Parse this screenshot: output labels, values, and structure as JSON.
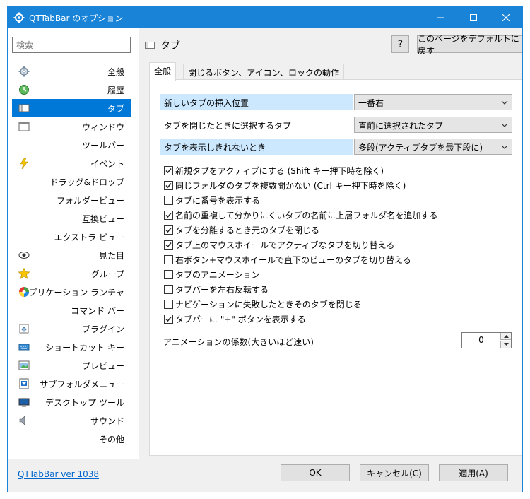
{
  "window": {
    "title": "QTTabBar のオプション"
  },
  "sidebar": {
    "search_placeholder": "検索",
    "items": [
      {
        "label": "全般",
        "icon": "gear-icon"
      },
      {
        "label": "履歴",
        "icon": "history-icon"
      },
      {
        "label": "タブ",
        "icon": "tab-icon",
        "selected": true
      },
      {
        "label": "ウィンドウ",
        "icon": "window-icon"
      },
      {
        "label": "ツールバー",
        "icon": ""
      },
      {
        "label": "イベント",
        "icon": "lightning-icon"
      },
      {
        "label": "ドラッグ&ドロップ",
        "icon": ""
      },
      {
        "label": "フォルダービュー",
        "icon": ""
      },
      {
        "label": "互換ビュー",
        "icon": ""
      },
      {
        "label": "エクストラ ビュー",
        "icon": ""
      },
      {
        "label": "見た目",
        "icon": "eye-icon"
      },
      {
        "label": "グループ",
        "icon": "star-icon"
      },
      {
        "label": "アプリケーション ランチャ",
        "icon": "launcher-icon"
      },
      {
        "label": "コマンド バー",
        "icon": ""
      },
      {
        "label": "プラグイン",
        "icon": "plugin-icon"
      },
      {
        "label": "ショートカット キー",
        "icon": "keyboard-icon"
      },
      {
        "label": "プレビュー",
        "icon": "preview-icon"
      },
      {
        "label": "サブフォルダメニュー",
        "icon": "subfolder-icon"
      },
      {
        "label": "デスクトップ ツール",
        "icon": "desktop-icon"
      },
      {
        "label": "サウンド",
        "icon": "speaker-icon"
      },
      {
        "label": "その他",
        "icon": ""
      }
    ]
  },
  "header": {
    "title": "タブ",
    "help_label": "?",
    "reset_label": "このページをデフォルトに戻す"
  },
  "tabs": [
    {
      "label": "全般",
      "active": true
    },
    {
      "label": "閉じるボタン、アイコン、ロックの動作",
      "active": false
    }
  ],
  "settings": [
    {
      "label": "新しいタブの挿入位置",
      "value": "一番右"
    },
    {
      "label": "タブを閉じたときに選択するタブ",
      "value": "直前に選択されたタブ"
    },
    {
      "label": "タブを表示しきれないとき",
      "value": "多段(アクティブタブを最下段に)"
    }
  ],
  "checkboxes": [
    {
      "label": "新規タブをアクティブにする (Shift キー押下時を除く)",
      "checked": true
    },
    {
      "label": "同じフォルダのタブを複数開かない (Ctrl キー押下時を除く)",
      "checked": true
    },
    {
      "label": "タブに番号を表示する",
      "checked": false
    },
    {
      "label": "名前の重複して分かりにくいタブの名前に上層フォルダ名を追加する",
      "checked": true
    },
    {
      "label": "タブを分離するとき元のタブを閉じる",
      "checked": true
    },
    {
      "label": "タブ上のマウスホイールでアクティブなタブを切り替える",
      "checked": true
    },
    {
      "label": "右ボタン+マウスホイールで直下のビューのタブを切り替える",
      "checked": false
    },
    {
      "label": "タブのアニメーション",
      "checked": false
    },
    {
      "label": "タブバーを左右反転する",
      "checked": false
    },
    {
      "label": "ナビゲーションに失敗したときそのタブを閉じる",
      "checked": false
    },
    {
      "label": "タブバーに \"+\" ボタンを表示する",
      "checked": true
    }
  ],
  "animation": {
    "label": "アニメーションの係数(大きいほど速い)",
    "value": "0"
  },
  "footer": {
    "version": "QTTabBar ver 1038",
    "ok": "OK",
    "cancel": "キャンセル(C)",
    "apply": "適用(A)"
  },
  "colors": {
    "titlebar": "#1883d7",
    "selection": "#0078d7",
    "highlight": "#cce8ff",
    "link": "#0066cc"
  }
}
